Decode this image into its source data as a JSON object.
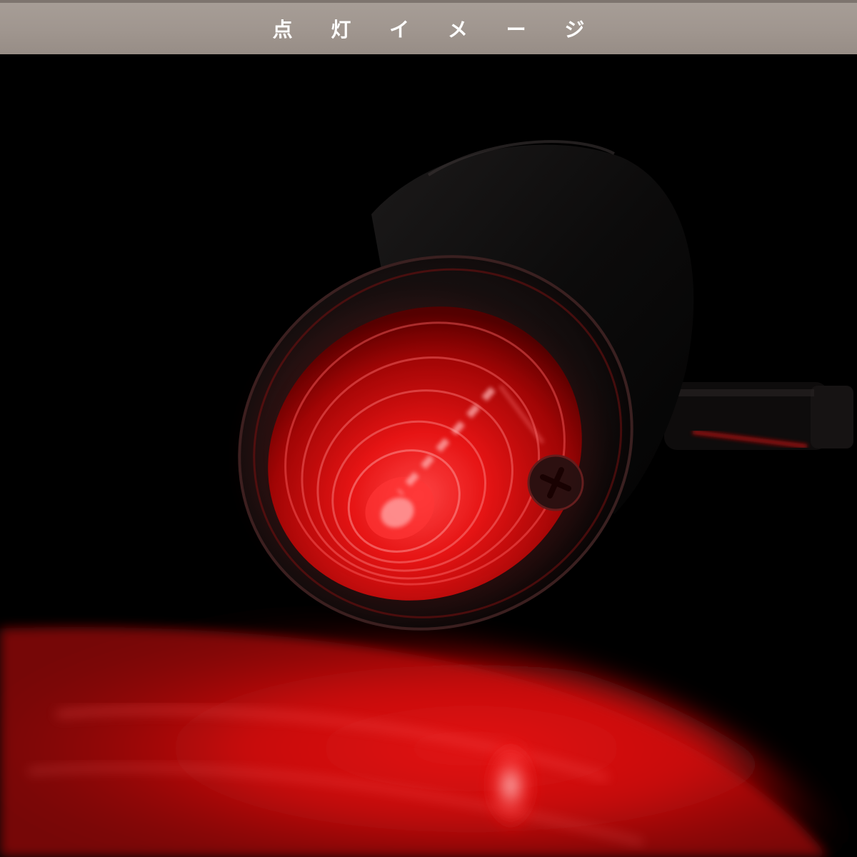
{
  "header": {
    "title": "点 灯 イ メ ー ジ"
  },
  "photo": {
    "subject": "red-lamp",
    "colors": {
      "background": "#000000",
      "header_bg": "#a0968f",
      "header_text": "#ffffff",
      "lamp_red": "#e01818",
      "glow_red": "#ff1a1a"
    }
  }
}
